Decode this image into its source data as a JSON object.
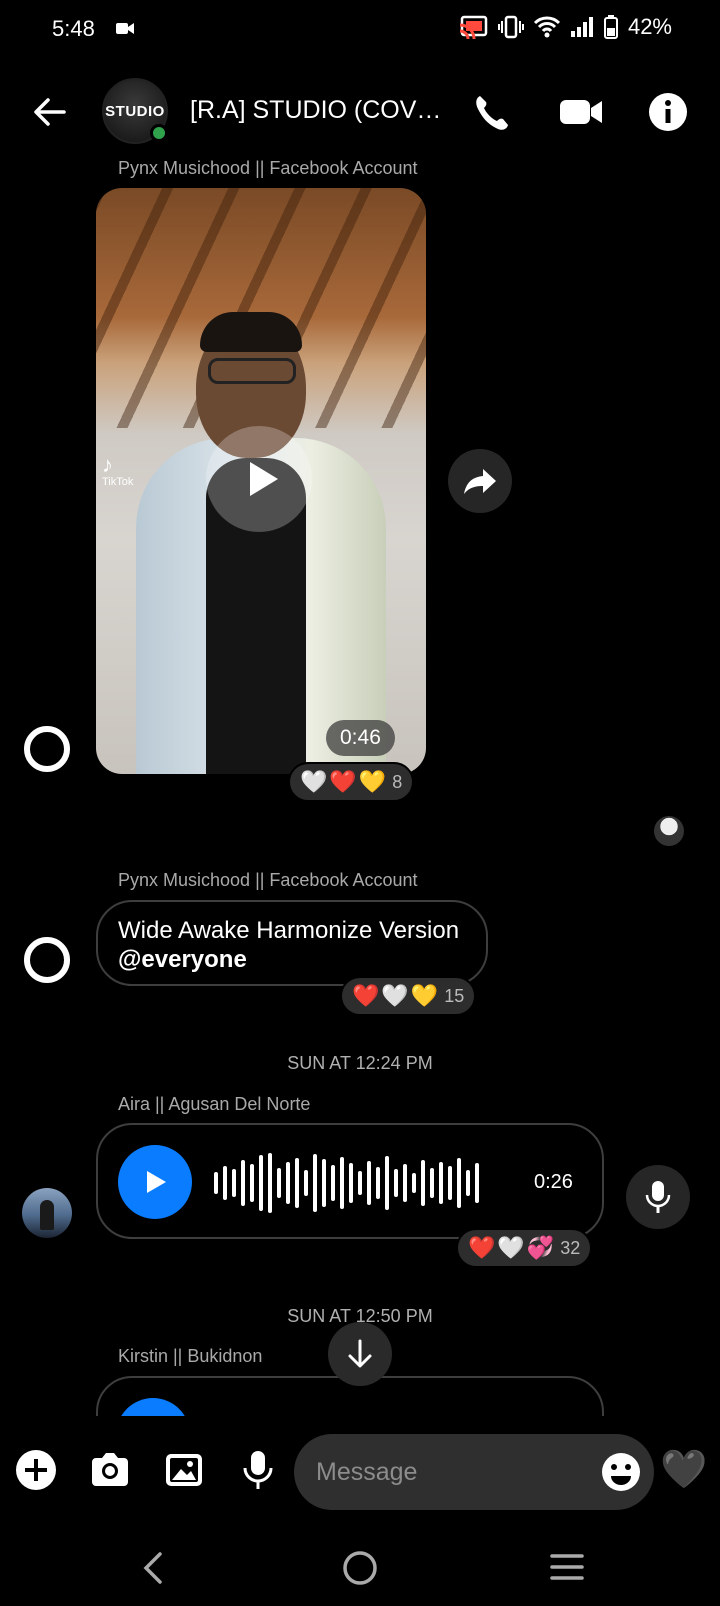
{
  "status_bar": {
    "time": "5:48",
    "battery": "42%"
  },
  "header": {
    "group_avatar_text": "STUDIO",
    "title": "[R.A] STUDIO (COVER..."
  },
  "messages": {
    "video_msg": {
      "sender": "Pynx Musichood || Facebook Account",
      "duration": "0:46",
      "watermark": "TikTok",
      "reactions": [
        "🤍",
        "❤️",
        "💛"
      ],
      "reaction_count": "8"
    },
    "text_msg": {
      "sender": "Pynx Musichood || Facebook Account",
      "line1": "Wide Awake Harmonize Version",
      "mention": "@everyone",
      "reactions": [
        "❤️",
        "🤍",
        "💛"
      ],
      "reaction_count": "15"
    },
    "timestamp1": "SUN AT 12:24 PM",
    "audio_msg": {
      "sender": "Aira || Agusan Del Norte",
      "duration": "0:26",
      "reactions": [
        "❤️",
        "🤍",
        "💞"
      ],
      "reaction_count": "32"
    },
    "timestamp2": "SUN AT 12:50 PM",
    "audio_msg2": {
      "sender": "Kirstin || Bukidnon"
    }
  },
  "composer": {
    "placeholder": "Message",
    "like_emoji": "🖤"
  },
  "colors": {
    "accent": "#0a7cff",
    "online": "#31a24c"
  },
  "icons": [
    "back-arrow-icon",
    "phone-icon",
    "video-camera-icon",
    "info-icon",
    "share-icon",
    "play-icon",
    "microphone-icon",
    "arrow-down-icon",
    "plus-icon",
    "camera-icon",
    "gallery-icon",
    "emoji-icon"
  ]
}
